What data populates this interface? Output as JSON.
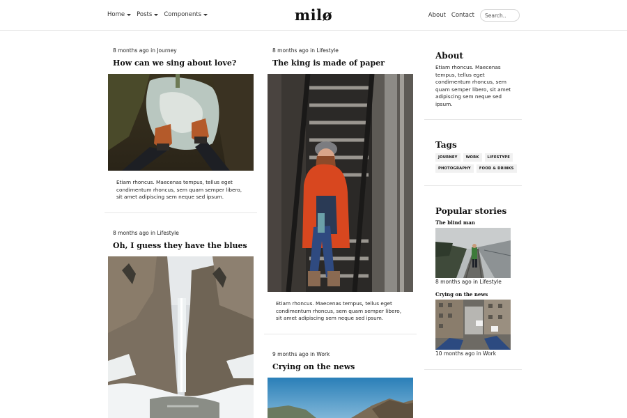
{
  "header": {
    "logo": "milø",
    "nav_left": [
      {
        "label": "Home"
      },
      {
        "label": "Posts"
      },
      {
        "label": "Components"
      }
    ],
    "nav_right": [
      {
        "label": "About"
      },
      {
        "label": "Contact"
      }
    ],
    "search_placeholder": "Search.."
  },
  "posts": [
    {
      "meta": "8 months ago in Journey",
      "title": "How can we sing about love?",
      "excerpt": "Etiam rhoncus. Maecenas tempus, tellus eget condimentum rhoncus, sem quam semper libero, sit amet adipiscing sem neque sed ipsum."
    },
    {
      "meta": "8 months ago in Lifestyle",
      "title": "Oh, I guess they have the blues"
    },
    {
      "meta": "8 months ago in Lifestyle",
      "title": "The king is made of paper",
      "excerpt": "Etiam rhoncus. Maecenas tempus, tellus eget condimentum rhoncus, sem quam semper libero, sit amet adipiscing sem neque sed ipsum."
    },
    {
      "meta": "9 months ago in Work",
      "title": "Crying on the news"
    }
  ],
  "sidebar": {
    "about_heading": "About",
    "about_text": "Etiam rhoncus. Maecenas tempus, tellus eget condimentum rhoncus, sem quam semper libero, sit amet adipiscing sem neque sed ipsum.",
    "tags_heading": "Tags",
    "tags": [
      "JOURNEY",
      "WORK",
      "LIFESTYPE",
      "PHOTOGRAPHY",
      "FOOD & DRINKS"
    ],
    "popular_heading": "Popular stories",
    "stories": [
      {
        "title": "The blind man",
        "meta": "8 months ago in Lifestyle"
      },
      {
        "title": "Crying on the news",
        "meta": "10 months ago in Work"
      }
    ]
  },
  "colors": {
    "divider": "#e6e6e6",
    "tag_bg": "#f1f1f1",
    "jacket": "#d8471f"
  }
}
